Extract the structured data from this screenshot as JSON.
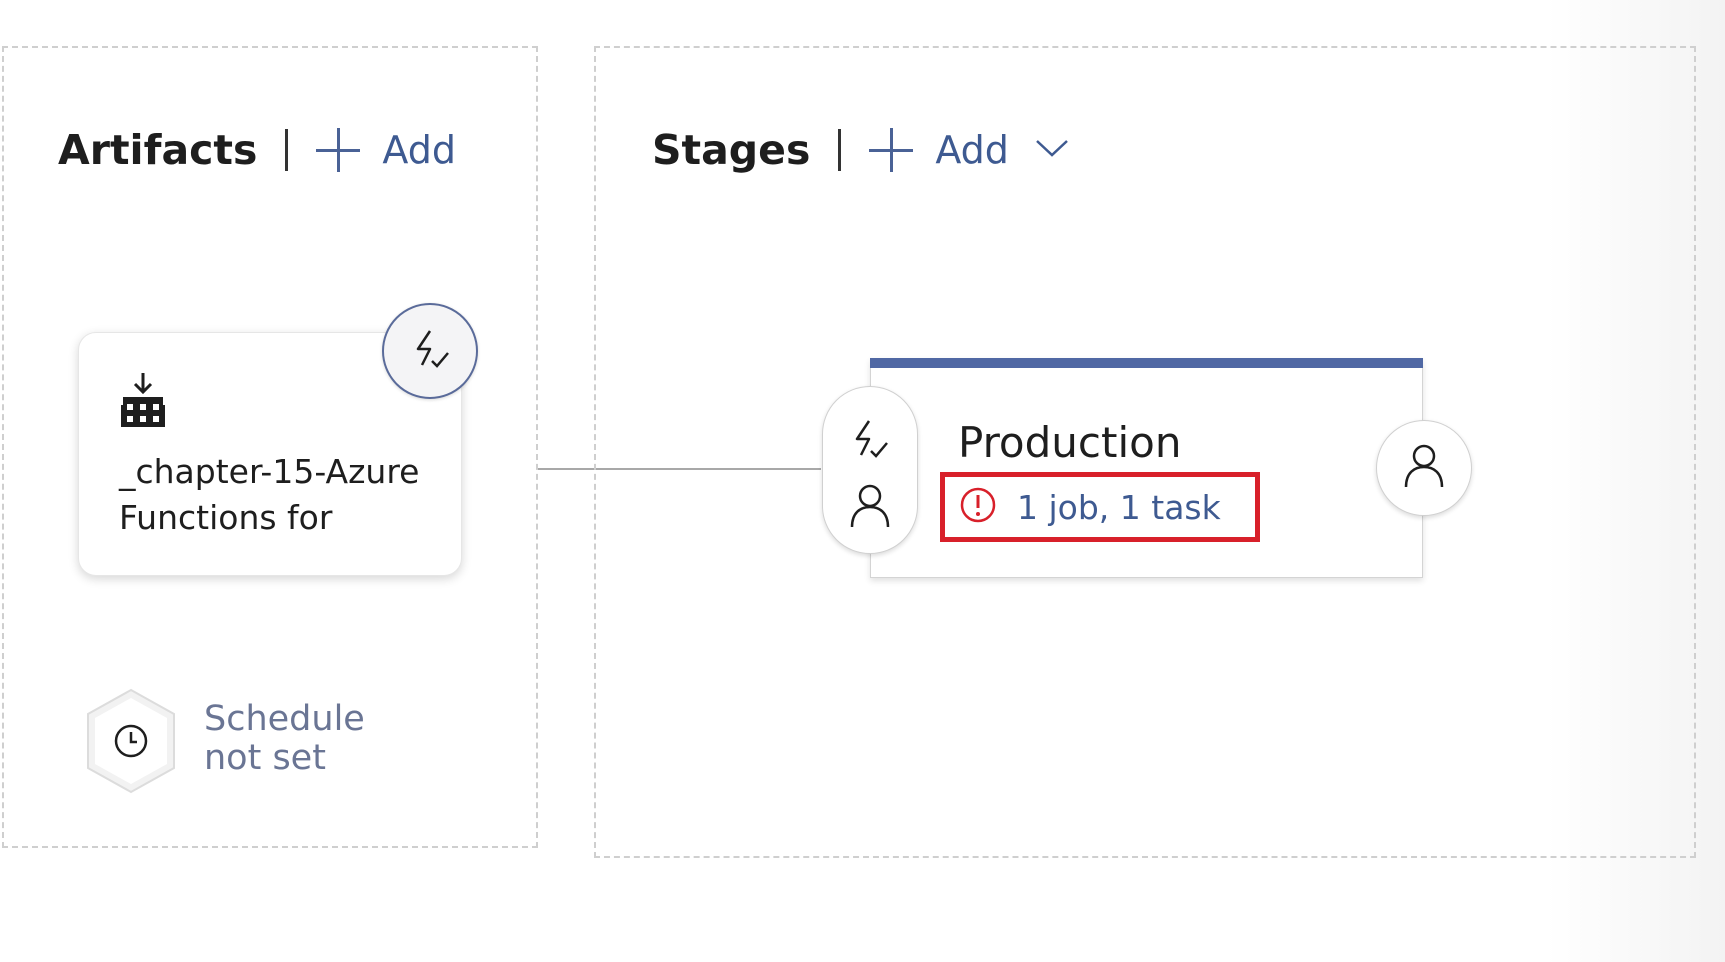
{
  "artifacts": {
    "title": "Artifacts",
    "add_label": "Add",
    "card": {
      "name": "_chapter-15-Azure Functions for",
      "icon": "build-artifact-icon",
      "trigger_icon": "continuous-deployment-trigger-icon"
    },
    "schedule": {
      "icon": "clock-icon",
      "text": "Schedule not set"
    }
  },
  "stages": {
    "title": "Stages",
    "add_label": "Add",
    "add_dropdown_icon": "chevron-down-icon",
    "stage": {
      "name": "Production",
      "tasks_text": "1 job, 1 task",
      "status_icon": "warning-circle-icon",
      "pre_icons": [
        "lightning-trigger-icon",
        "pre-approval-person-icon"
      ],
      "post_icon": "post-approval-person-icon"
    }
  },
  "colors": {
    "accent": "#3e5a91",
    "stage_bar": "#5068a4",
    "highlight_box": "#d8202a",
    "warning": "#d8202a"
  }
}
